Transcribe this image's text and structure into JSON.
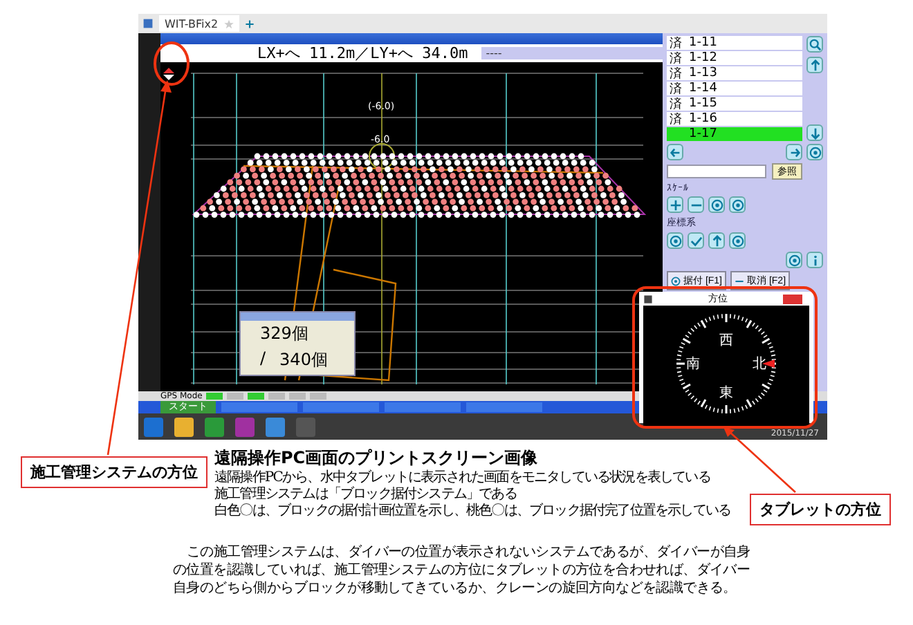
{
  "browser_tab": {
    "title": "WIT-BFix2"
  },
  "app": {
    "position_readout": "LX+へ 11.2m／LY+へ 34.0m",
    "readout_2": "----",
    "drawing_labels": [
      "(-6.0)",
      "-6.0"
    ],
    "block_list": [
      {
        "mark": "済",
        "label": "1-11",
        "selected": false
      },
      {
        "mark": "済",
        "label": "1-12",
        "selected": false
      },
      {
        "mark": "済",
        "label": "1-13",
        "selected": false
      },
      {
        "mark": "済",
        "label": "1-14",
        "selected": false
      },
      {
        "mark": "済",
        "label": "1-15",
        "selected": false
      },
      {
        "mark": "済",
        "label": "1-16",
        "selected": false
      },
      {
        "label": "1-17",
        "selected": true
      }
    ],
    "reference_button": "参照",
    "scale_label": "ｽｹｰﾙ",
    "coordinate_label": "座標系",
    "buttons": [
      "据付 [F1]",
      "取消 [F2]"
    ],
    "status_mode": "GPS Mode",
    "start_button": "スタート"
  },
  "counter_window": {
    "placed": "329個",
    "separator": "/",
    "total": "340個"
  },
  "tablet_window": {
    "title": "方位",
    "directions": [
      "西",
      "北",
      "東",
      "南"
    ]
  },
  "clock": {
    "date": "2015/11/27"
  },
  "callouts": [
    {
      "text": "施工管理システムの方位"
    },
    {
      "text": "タブレットの方位"
    }
  ],
  "caption": {
    "title": "遠隔操作PC画面のプリントスクリーン画像",
    "lines": [
      "遠隔操作PCから、水中タブレットに表示された画面をモニタしている状況を表している",
      "施工管理システムは「ブロック据付システム」である",
      "白色〇は、ブロックの据付計画位置を示し、桃色〇は、ブロック据付完了位置を示している"
    ]
  },
  "paragraph": "この施工管理システムは、ダイバーの位置が表示されないシステムであるが、ダイバーが自身の位置を認識していれば、施工管理システムの方位にタブレットの方位を合わせれば、ダイバー自身のどちら側からブロックが移動してきているか、クレーンの旋回方向などを認識できる。"
}
